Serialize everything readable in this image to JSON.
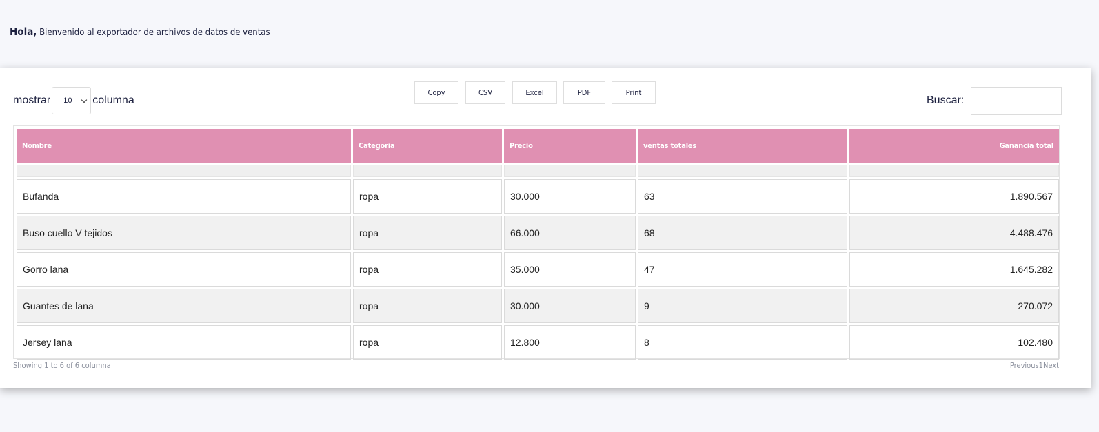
{
  "header": {
    "hola": "Hola,",
    "welcome": "Bienvenido al exportador de archivos de datos de ventas"
  },
  "length_control": {
    "prefix": "mostrar",
    "value": "10",
    "suffix": "columna"
  },
  "export_buttons": [
    "Copy",
    "CSV",
    "Excel",
    "PDF",
    "Print"
  ],
  "search": {
    "label": "Buscar:",
    "value": ""
  },
  "table": {
    "columns": [
      "Nombre",
      "Categoria",
      "Precio",
      "ventas totales",
      "Ganancia total"
    ],
    "rows": [
      [
        "Bufanda",
        "ropa",
        "30.000",
        "63",
        "1.890.567"
      ],
      [
        "Buso cuello V tejidos",
        "ropa",
        "66.000",
        "68",
        "4.488.476"
      ],
      [
        "Gorro lana",
        "ropa",
        "35.000",
        "47",
        "1.645.282"
      ],
      [
        "Guantes de lana",
        "ropa",
        "30.000",
        "9",
        "270.072"
      ],
      [
        "Jersey lana",
        "ropa",
        "12.800",
        "8",
        "102.480"
      ]
    ]
  },
  "footer": {
    "info": "Showing 1 to 6 of 6 columna",
    "pagination": {
      "previous": "Previous",
      "current": "1",
      "next": "Next"
    }
  },
  "colors": {
    "header_bg": "#e090b2",
    "page_bg": "#f6f7fb",
    "text": "#1e2240"
  }
}
